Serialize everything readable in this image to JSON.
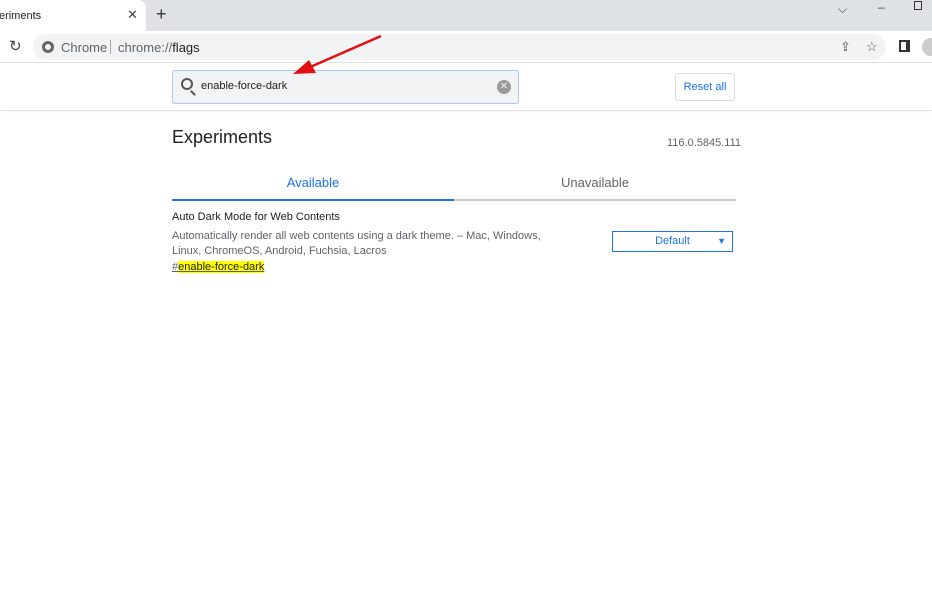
{
  "browser": {
    "tab_title": "Experiments",
    "site_label": "Chrome",
    "url_prefix": "chrome://",
    "url_path": "flags"
  },
  "search": {
    "value": "enable-force-dark",
    "clear_icon": "clear-icon"
  },
  "header": {
    "reset_label": "Reset all"
  },
  "page": {
    "title": "Experiments",
    "version": "116.0.5845.111",
    "tabs": [
      {
        "label": "Available",
        "active": true
      },
      {
        "label": "Unavailable",
        "active": false
      }
    ]
  },
  "experiment": {
    "name": "Auto Dark Mode for Web Contents",
    "description": "Automatically render all web contents using a dark theme. – Mac, Windows, Linux, ChromeOS, Android, Fuchsia, Lacros",
    "hash": "#",
    "link": "enable-force-dark",
    "selected": "Default"
  },
  "colors": {
    "accent": "#1a73e8",
    "highlight": "#ffff00",
    "annotation_arrow": "#e01010"
  }
}
